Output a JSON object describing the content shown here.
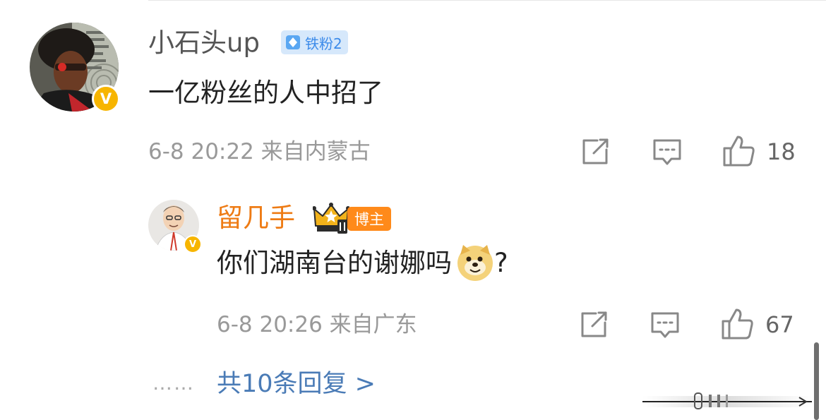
{
  "comment": {
    "username": "小石头up",
    "fan_badge": "铁粉2",
    "text": "一亿粉丝的人中招了",
    "meta": "6-8 20:22 来自内蒙古",
    "like_count": "18"
  },
  "reply": {
    "username": "留几手",
    "role_badge": "博主",
    "text": "你们湖南台的谢娜吗",
    "text_suffix": "?",
    "meta": "6-8 20:26 来自广东",
    "like_count": "67"
  },
  "more_replies": {
    "dots": "……",
    "label": "共10条回复 >"
  },
  "colors": {
    "accent_orange": "#ee7b14",
    "link_blue": "#4a7bb6",
    "verified_gold": "#f7b500",
    "fan_badge_bg": "#d6e8fb"
  }
}
